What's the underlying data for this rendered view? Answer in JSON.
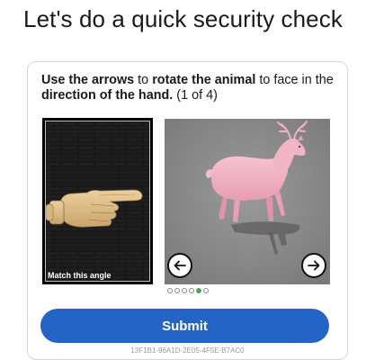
{
  "page": {
    "title": "Let's do a quick security check"
  },
  "challenge": {
    "instruction_part1": "Use the arrows",
    "instruction_part2": " to ",
    "instruction_part3": "rotate the animal",
    "instruction_part4": " to face in the ",
    "instruction_part5": "direction of the hand.",
    "instruction_part6": " (1 of 4)",
    "reference_caption": "Match this angle",
    "progress": {
      "total": 6,
      "active_index": 4
    },
    "submit_label": "Submit",
    "footer_text": "13F1B1-96A1D-2E05-4F5E-B7AC0"
  },
  "icons": {
    "left_arrow": "arrow-left-icon",
    "right_arrow": "arrow-right-icon"
  },
  "colors": {
    "submit": "#2364c4",
    "active_dot": "#5b9b6b",
    "stage_bg": "#8f8f8f",
    "animal": "#f3b6c6"
  }
}
